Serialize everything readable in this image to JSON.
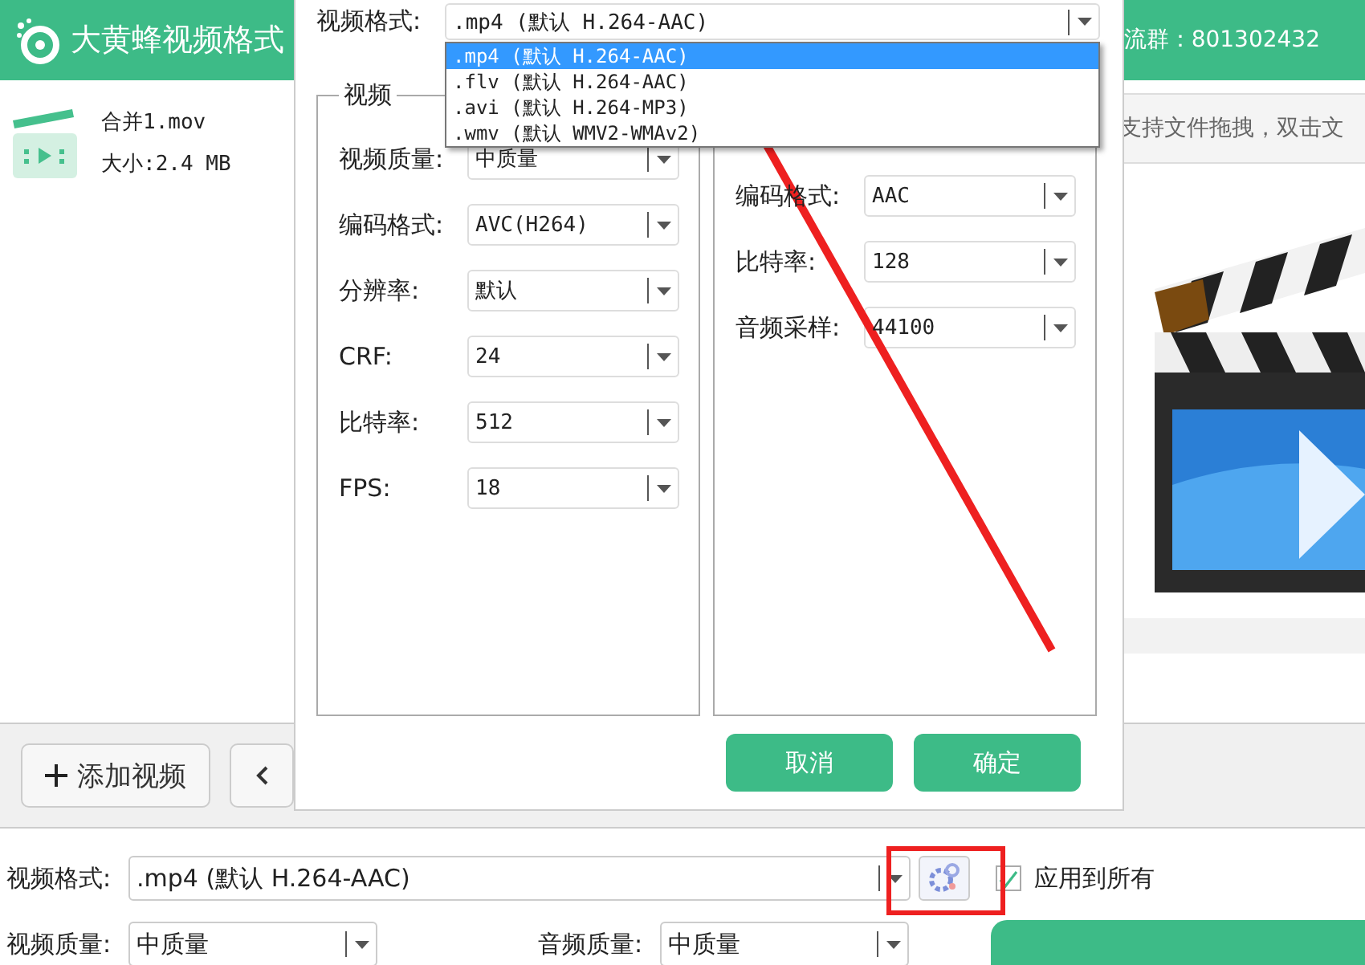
{
  "app": {
    "title": "大黄蜂视频格式",
    "group_info": "流群：801302432",
    "drop_hint": "支持文件拖拽，双击文"
  },
  "files": [
    {
      "name": "合并1.mov",
      "size": "大小:2.4 MB"
    }
  ],
  "toolbar": {
    "add_button": "添加视频"
  },
  "dialog": {
    "format_label": "视频格式:",
    "format_value": ".mp4 (默认 H.264-AAC)",
    "options": [
      {
        "label": ".mp4 (默认 H.264-AAC)",
        "selected": true
      },
      {
        "label": ".flv (默认 H.264-AAC)",
        "selected": false
      },
      {
        "label": ".avi (默认 H.264-MP3)",
        "selected": false
      },
      {
        "label": ".wmv (默认 WMV2-WMAv2)",
        "selected": false
      }
    ],
    "video_group": {
      "title": "视频",
      "rows": [
        {
          "label": "视频质量:",
          "value": "中质量"
        },
        {
          "label": "编码格式:",
          "value": "AVC(H264)"
        },
        {
          "label": "分辨率:",
          "value": "默认"
        },
        {
          "label": "CRF:",
          "value": "24"
        },
        {
          "label": "比特率:",
          "value": "512"
        },
        {
          "label": "FPS:",
          "value": "18"
        }
      ]
    },
    "audio_group": {
      "rows": [
        {
          "label": "编码格式:",
          "value": "AAC"
        },
        {
          "label": "比特率:",
          "value": "128"
        },
        {
          "label": "音频采样:",
          "value": "44100"
        }
      ]
    },
    "buttons": [
      "取消",
      "确定"
    ]
  },
  "bottom": {
    "format_label": "视频格式:",
    "format_value": ".mp4 (默认 H.264-AAC)",
    "apply_all": {
      "label": "应用到所有",
      "checked": true
    },
    "video_quality_label": "视频质量:",
    "video_quality": "中质量",
    "audio_quality_label": "音频质量:",
    "audio_quality": "中质量"
  }
}
